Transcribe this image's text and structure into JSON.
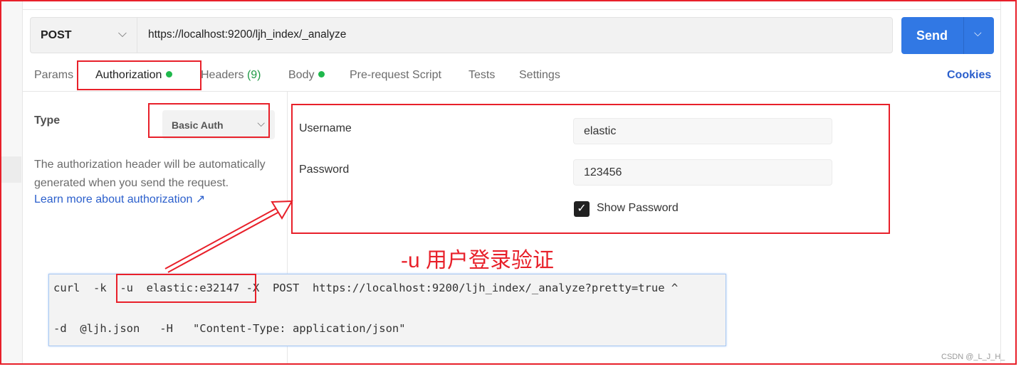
{
  "request": {
    "method": "POST",
    "url": "https://localhost:9200/ljh_index/_analyze",
    "send_label": "Send"
  },
  "tabs": [
    {
      "label": "Params"
    },
    {
      "label": "Authorization",
      "dot": true
    },
    {
      "label": "Headers",
      "count": "(9)"
    },
    {
      "label": "Body",
      "dot": true
    },
    {
      "label": "Pre-request Script"
    },
    {
      "label": "Tests"
    },
    {
      "label": "Settings"
    }
  ],
  "cookies_label": "Cookies",
  "auth": {
    "type_label": "Type",
    "type_value": "Basic Auth",
    "description": "The authorization header will be automatically generated when you send the request.",
    "learn_more": "Learn more about authorization ↗",
    "username_label": "Username",
    "username_value": "elastic",
    "password_label": "Password",
    "password_value": "123456",
    "show_password_label": "Show Password",
    "show_password_checked": true
  },
  "annotation": "-u 用户登录验证",
  "code": {
    "line1": "curl  -k  -u  elastic:e32147 -X  POST  https://localhost:9200/ljh_index/_analyze?pretty=true ^",
    "line2": "-d  @ljh.json   -H   \"Content-Type: application/json\""
  },
  "watermark": "CSDN @_L_J_H_",
  "colors": {
    "accent": "#3178e4",
    "annotation": "#e8202a",
    "status_dot": "#1fb84c",
    "link": "#2b5fcc"
  }
}
